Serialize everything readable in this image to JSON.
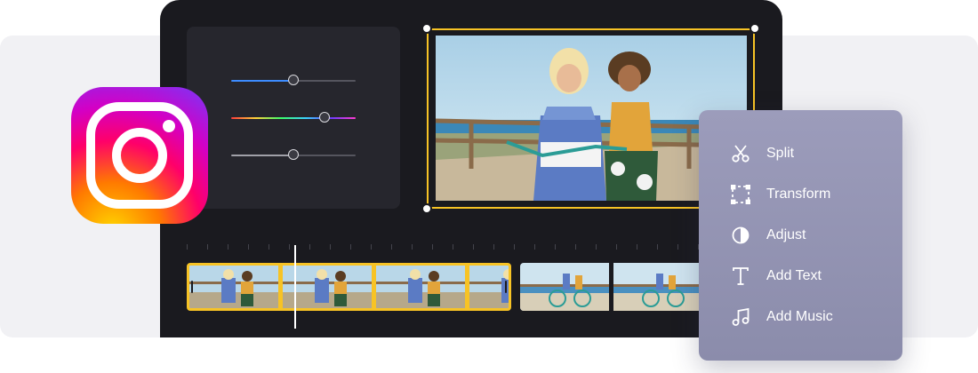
{
  "context_menu": {
    "items": [
      {
        "label": "Split",
        "icon": "scissors-icon"
      },
      {
        "label": "Transform",
        "icon": "transform-icon"
      },
      {
        "label": "Adjust",
        "icon": "adjust-icon"
      },
      {
        "label": "Add Text",
        "icon": "text-icon"
      },
      {
        "label": "Add Music",
        "icon": "music-icon"
      }
    ]
  },
  "adjust_panel": {
    "sliders": [
      {
        "type": "brightness",
        "value": 0.5
      },
      {
        "type": "hue",
        "value": 0.75
      },
      {
        "type": "saturation",
        "value": 0.5
      }
    ]
  },
  "timeline": {
    "playhead_position": 0.33
  },
  "colors": {
    "editor_bg": "#1a1a1f",
    "selection": "#f7c325",
    "menu_bg": "#9394b3"
  },
  "brand": "instagram-logo"
}
